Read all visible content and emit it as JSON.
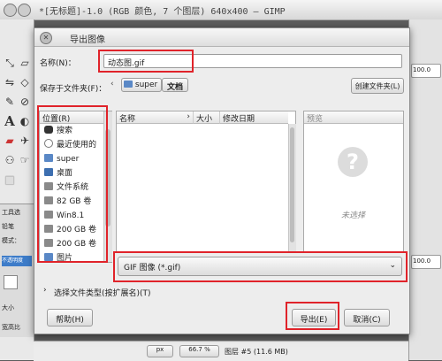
{
  "gimp": {
    "title": "*[无标题]-1.0 (RGB 颜色, 7 个图层) 640x400 – GIMP",
    "tool_options": [
      "工具选",
      "铅笔",
      "模式：",
      "不透明度",
      "大小",
      "宽高比"
    ],
    "right_values": [
      "100.0",
      "100.0"
    ],
    "status": {
      "unit": "px",
      "zoom": "66.7 %",
      "layer": "图层 #5 (11.6 MB)"
    }
  },
  "dialog": {
    "title": "导出图像",
    "name_label": "名称(N)：",
    "filename": "动态图.gif",
    "save_in_label": "保存于文件夹(F)：",
    "breadcrumb": [
      "super",
      "文档"
    ],
    "create_folder": "创建文件夹(L)",
    "places_header": "位置(R)",
    "places": [
      {
        "label": "搜索",
        "icon": "binoculars-icon"
      },
      {
        "label": "最近使用的",
        "icon": "clock-icon"
      },
      {
        "label": "super",
        "icon": "home-folder-icon"
      },
      {
        "label": "桌面",
        "icon": "desktop-icon"
      },
      {
        "label": "文件系统",
        "icon": "drive-icon"
      },
      {
        "label": "82 GB 卷",
        "icon": "drive-icon"
      },
      {
        "label": "Win8.1",
        "icon": "drive-icon"
      },
      {
        "label": "200 GB 卷",
        "icon": "drive-icon"
      },
      {
        "label": "200 GB 卷",
        "icon": "drive-icon"
      },
      {
        "label": "图片",
        "icon": "folder-icon"
      }
    ],
    "files_columns": {
      "name": "名称",
      "size": "大小",
      "modified": "修改日期"
    },
    "preview_header": "预览",
    "preview_empty": "未选择",
    "file_type": "GIF 图像 (*.gif)",
    "select_type": "选择文件类型(按扩展名)(T)",
    "help": "帮助(H)",
    "export": "导出(E)",
    "cancel": "取消(C)"
  },
  "colors": {
    "highlight": "#e0232a",
    "accent": "#3d7cc9"
  }
}
